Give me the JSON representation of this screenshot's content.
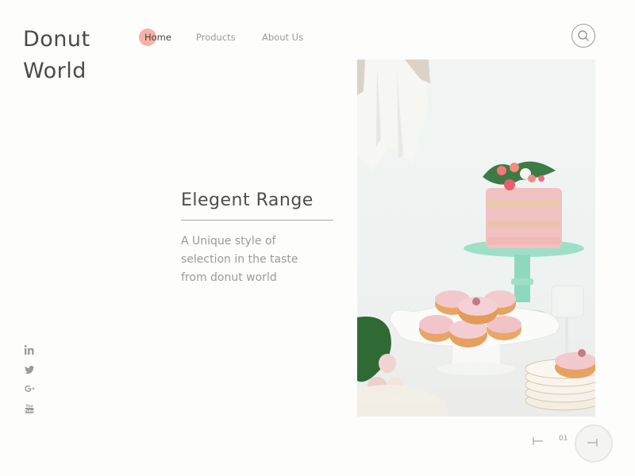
{
  "brand": {
    "line1": "Donut",
    "line2": "World"
  },
  "nav": {
    "items": [
      {
        "label": "Home",
        "active": true
      },
      {
        "label": "Products",
        "active": false
      },
      {
        "label": "About Us",
        "active": false
      }
    ],
    "accent_color": "#f6a99c"
  },
  "search": {
    "icon": "search-icon"
  },
  "hero": {
    "title": "Elegent Range",
    "description_lines": [
      "A Unique style of",
      "selection in the taste",
      "from donut world"
    ],
    "image_description": "Pink naked cake with flowers on a mint cake stand, glazed pink donuts on a white cake stand, stacked plates and roses"
  },
  "social": {
    "items": [
      {
        "name": "linkedin",
        "glyph": "in"
      },
      {
        "name": "twitter",
        "glyph": "t"
      },
      {
        "name": "google-plus",
        "glyph": "G+"
      },
      {
        "name": "youtube",
        "glyph": "You"
      }
    ]
  },
  "pager": {
    "current": "01",
    "prev_icon": "first-page-icon",
    "next_icon": "last-page-icon"
  }
}
